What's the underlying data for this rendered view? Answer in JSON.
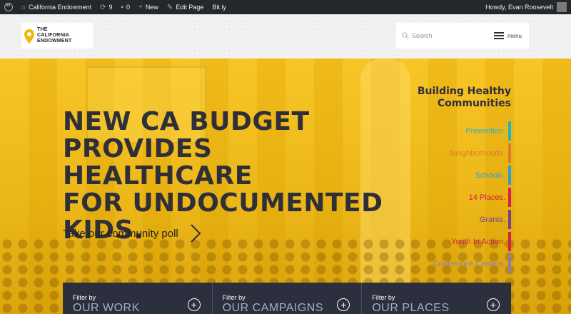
{
  "adminbar": {
    "site_name": "California Endowment",
    "updates_count": "9",
    "comments_count": "0",
    "new_label": "New",
    "edit_label": "Edit Page",
    "bitly_label": "Bit.ly",
    "greeting": "Howdy, Evan Roosevelt"
  },
  "header": {
    "logo_line1": "THE",
    "logo_line2": "CALIFORNIA",
    "logo_line3": "ENDOWMENT",
    "search_placeholder": "Search",
    "menu_label": "menu"
  },
  "hero": {
    "headline_1": "NEW CA BUDGET",
    "headline_2": "PROVIDES HEALTHCARE",
    "headline_3": "FOR UNDOCUMENTED",
    "headline_4": "KIDS.",
    "poll_link": "Take our community poll"
  },
  "bhc": {
    "title_1": "Building Healthy",
    "title_2": "Communities",
    "items": [
      {
        "label": "Prevention.",
        "color": "#1fb3c7"
      },
      {
        "label": "Neighborhoods.",
        "color": "#e07a2a"
      },
      {
        "label": "Schools.",
        "color": "#2a9fd6"
      },
      {
        "label": "14 Places.",
        "color": "#d6204a"
      },
      {
        "label": "Grants.",
        "color": "#7a3d8e"
      },
      {
        "label": "Youth In Action.",
        "color": "#d6204a"
      },
      {
        "label": "Conference Centers.",
        "color": "#8a7fb0"
      }
    ]
  },
  "filters": [
    {
      "small": "Filter by",
      "big": "OUR WORK"
    },
    {
      "small": "Filter by",
      "big": "OUR CAMPAIGNS"
    },
    {
      "small": "Filter by",
      "big": "OUR PLACES"
    }
  ]
}
